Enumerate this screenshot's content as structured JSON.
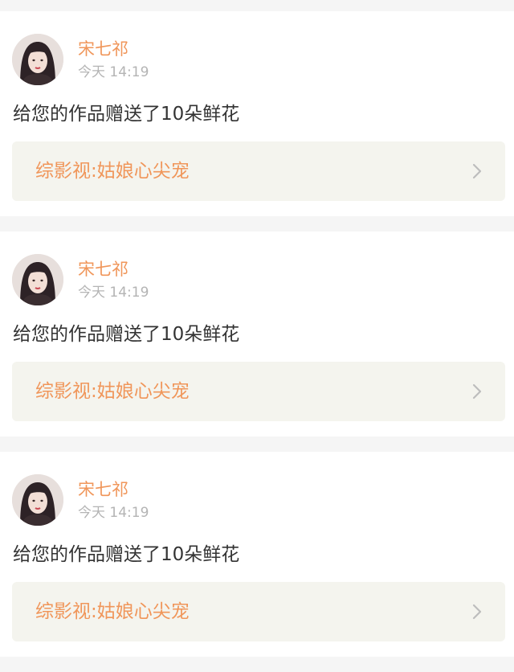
{
  "notifications": [
    {
      "username": "宋七祁",
      "time": "今天 14:19",
      "message": "给您的作品赠送了10朵鲜花",
      "work_title": "综影视:姑娘心尖宠"
    },
    {
      "username": "宋七祁",
      "time": "今天 14:19",
      "message": "给您的作品赠送了10朵鲜花",
      "work_title": "综影视:姑娘心尖宠"
    },
    {
      "username": "宋七祁",
      "time": "今天 14:19",
      "message": "给您的作品赠送了10朵鲜花",
      "work_title": "综影视:姑娘心尖宠"
    }
  ],
  "colors": {
    "accent": "#f0965a",
    "timestamp": "#b4b4b4",
    "message": "#333333",
    "link_bg": "#f4f4ee",
    "page_bg": "#f5f5f5"
  },
  "icons": {
    "avatar": "user-avatar-photo",
    "link_arrow": "chevron-right-icon"
  }
}
